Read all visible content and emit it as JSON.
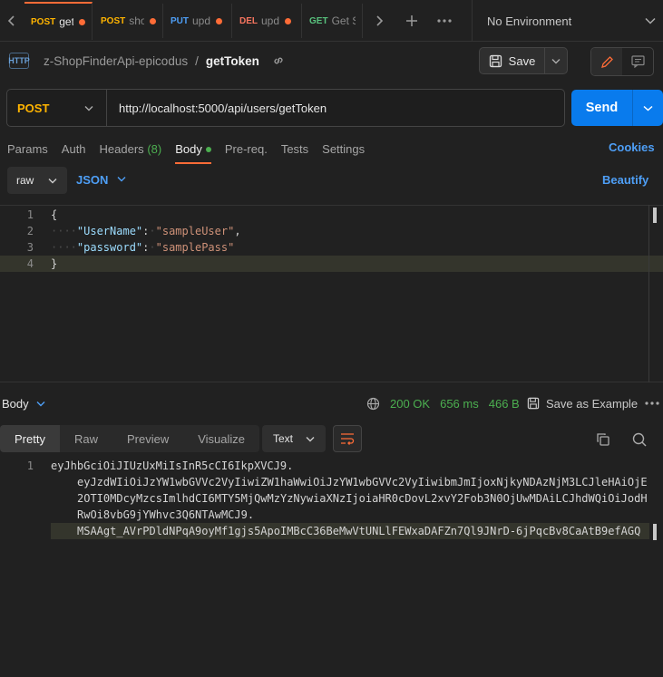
{
  "tabs": [
    {
      "method": "POST",
      "name": "get",
      "active": true
    },
    {
      "method": "POST",
      "name": "sho",
      "active": false
    },
    {
      "method": "PUT",
      "name": "upd",
      "active": false
    },
    {
      "method": "DEL",
      "name": "upd",
      "active": false
    },
    {
      "method": "GET",
      "name": "Get Sh",
      "active": false
    }
  ],
  "environment": "No Environment",
  "breadcrumb": {
    "collection": "z-ShopFinderApi-epicodus",
    "separator": "/",
    "request": "getToken"
  },
  "save_label": "Save",
  "request": {
    "method": "POST",
    "url": "http://localhost:5000/api/users/getToken"
  },
  "send_label": "Send",
  "request_tabs": {
    "params": "Params",
    "auth": "Auth",
    "headers": "Headers",
    "headers_count": "(8)",
    "body": "Body",
    "prereq": "Pre-req.",
    "tests": "Tests",
    "settings": "Settings",
    "cookies": "Cookies"
  },
  "body_options": {
    "mode": "raw",
    "language": "JSON",
    "beautify": "Beautify"
  },
  "editor": {
    "line_numbers": [
      "1",
      "2",
      "3",
      "4"
    ],
    "open_brace": "{",
    "close_brace": "}",
    "key1": "\"UserName\"",
    "val1": "\"sampleUser\"",
    "key2": "\"password\"",
    "val2": "\"samplePass\""
  },
  "response": {
    "label": "Body",
    "status": "200 OK",
    "time": "656 ms",
    "size": "466 B",
    "save_example": "Save as Example",
    "view_tabs": {
      "pretty": "Pretty",
      "raw": "Raw",
      "preview": "Preview",
      "visualize": "Visualize"
    },
    "format": "Text",
    "line_number": "1",
    "lines": [
      "eyJhbGciOiJIUzUxMiIsInR5cCI6IkpXVCJ9.",
      "eyJzdWIiOiJzYW1wbGVVc2VyIiwiZW1haWwiOiJzYW1wbGVVc2VyIiwibmJmIjoxNjkyNDAzNjM3LCJleHAiOjE",
      "2OTI0MDcyMzcsImlhdCI6MTY5MjQwMzYzNywiaXNzIjoiaHR0cDovL2xvY2Fob3N0OjUwMDAiLCJhdWQiOiJodH",
      "RwOi8vbG9jYWhvc3Q6NTAwMCJ9.",
      "MSAAgt_AVrPDldNPqA9oyMf1gjs5ApoIMBcC36BeMwVtUNLlFEWxaDAFZn7Ql9JNrD-6jPqcBv8CaAtB9efAGQ"
    ]
  },
  "colors": {
    "accent": "#ff6c37",
    "send": "#097bed",
    "link": "#4e9ff7",
    "success": "#4caf50"
  }
}
